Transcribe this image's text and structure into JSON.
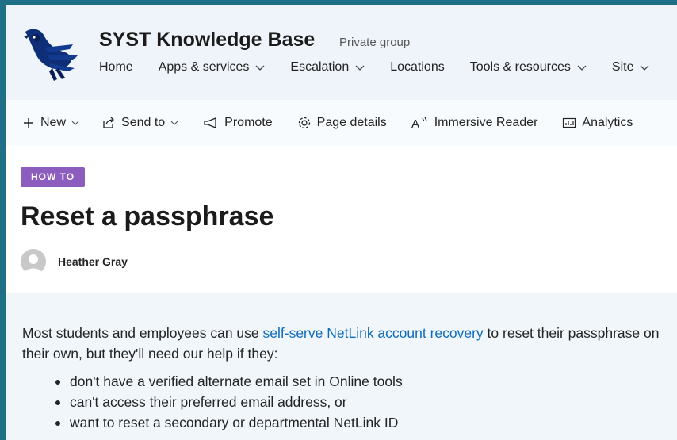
{
  "header": {
    "site_title": "SYST Knowledge Base",
    "privacy": "Private group",
    "nav": [
      {
        "label": "Home",
        "has_dropdown": false
      },
      {
        "label": "Apps & services",
        "has_dropdown": true
      },
      {
        "label": "Escalation",
        "has_dropdown": true
      },
      {
        "label": "Locations",
        "has_dropdown": false
      },
      {
        "label": "Tools & resources",
        "has_dropdown": true
      },
      {
        "label": "Site",
        "has_dropdown": true
      }
    ]
  },
  "command_bar": {
    "new": "New",
    "send_to": "Send to",
    "promote": "Promote",
    "page_details": "Page details",
    "immersive_reader": "Immersive Reader",
    "analytics": "Analytics"
  },
  "page": {
    "tag": "HOW TO",
    "title": "Reset a passphrase",
    "author": "Heather Gray"
  },
  "body": {
    "para_before": "Most students and employees can use ",
    "link_text": "self-serve NetLink account recovery",
    "para_after": " to reset their passphrase on their own, but they'll need our help if they:",
    "bullets": [
      "don't have a verified alternate email set in Online tools",
      "can't access their preferred email address, or",
      "want to reset a secondary or departmental NetLink ID"
    ]
  },
  "colors": {
    "accent_tag": "#8c5dbf",
    "link": "#0f6cbd",
    "header_bg": "#eef4fa",
    "frame_border": "#1f6f86"
  }
}
